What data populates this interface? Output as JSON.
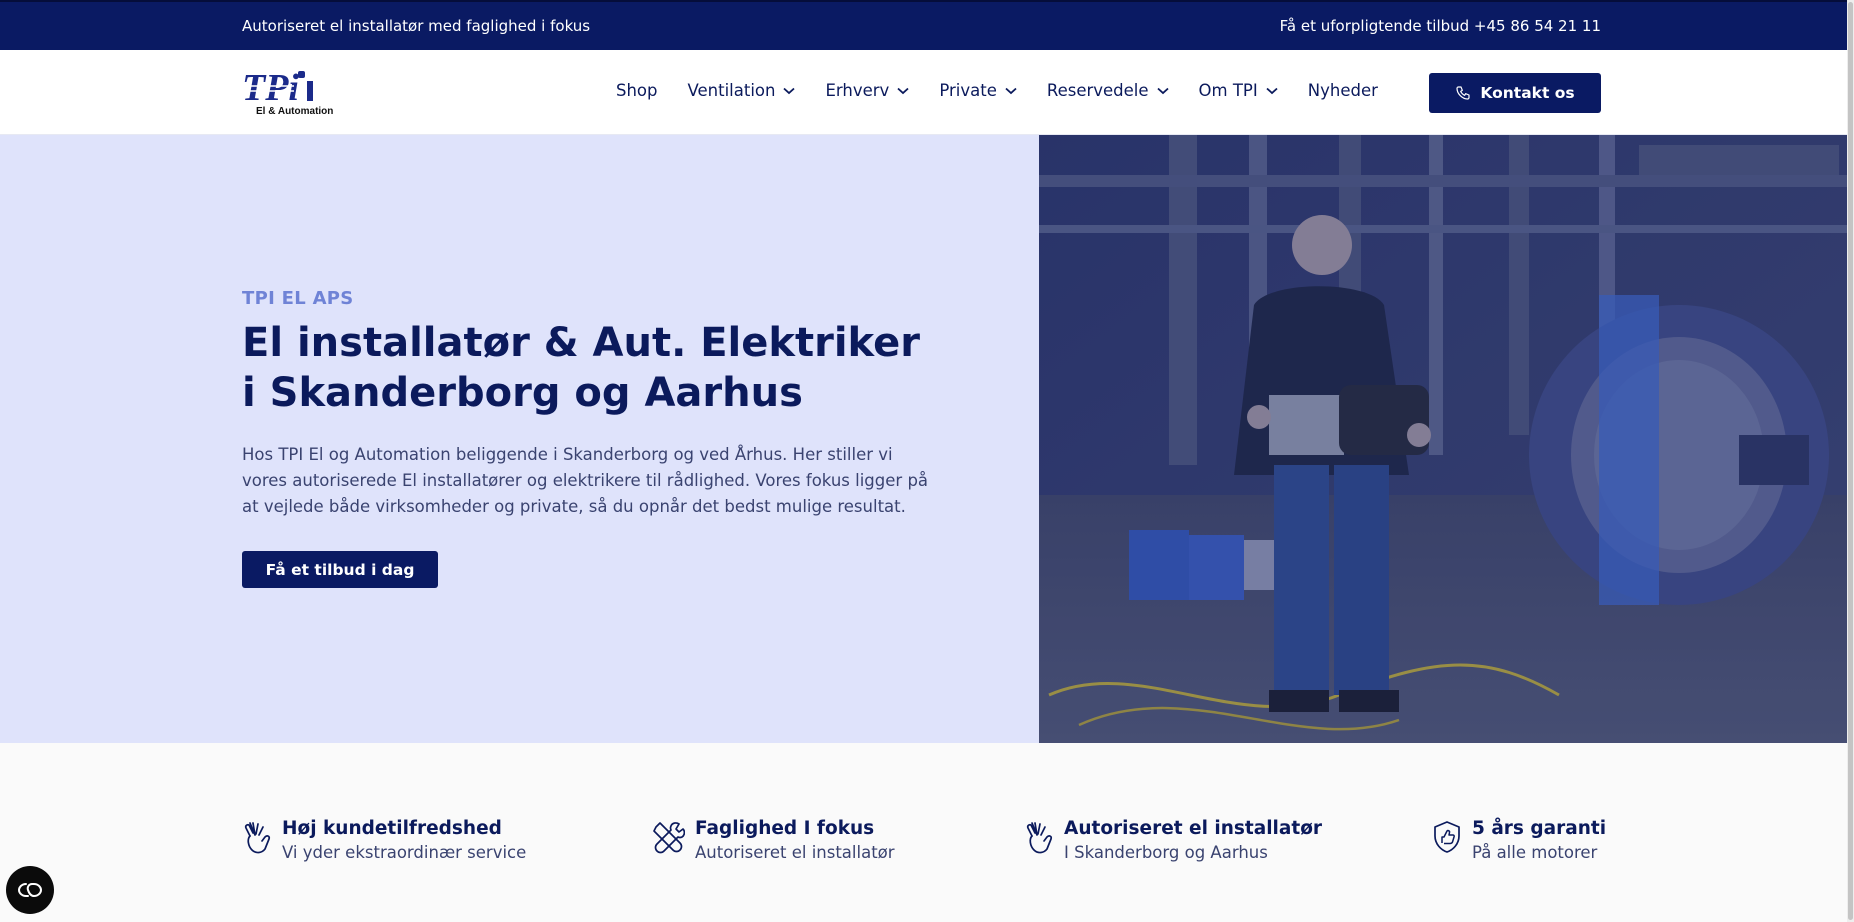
{
  "topbar": {
    "left_text": "Autoriseret el installatør med faglighed i fokus",
    "right_text": "Få et uforpligtende tilbud +45 86 54 21 11"
  },
  "logo": {
    "main": "TPi",
    "sub": "El & Automation"
  },
  "nav": {
    "items": [
      {
        "label": "Shop",
        "dropdown": false
      },
      {
        "label": "Ventilation",
        "dropdown": true
      },
      {
        "label": "Erhverv",
        "dropdown": true
      },
      {
        "label": "Private",
        "dropdown": true
      },
      {
        "label": "Reservedele",
        "dropdown": true
      },
      {
        "label": "Om TPI",
        "dropdown": true
      },
      {
        "label": "Nyheder",
        "dropdown": false
      }
    ],
    "cta_label": "Kontakt os"
  },
  "hero": {
    "eyebrow": "TPI EL APS",
    "title": "El installatør & Aut. Elektriker i Skanderborg og Aarhus",
    "lead": "Hos TPI El og Automation beliggende i Skanderborg og ved Århus. Her stiller vi vores autoriserede El installatører og elektrikere til rådlighed. Vores fokus ligger på at vejlede både virksomheder og private, så du opnår det bedst mulige resultat.",
    "button": "Få et tilbud i dag"
  },
  "features": [
    {
      "icon": "hand-icon",
      "title": "Høj kundetilfredshed",
      "subtitle": "Vi yder ekstraordinær service"
    },
    {
      "icon": "tools-icon",
      "title": "Faglighed I fokus",
      "subtitle": "Autoriseret el installatør"
    },
    {
      "icon": "hand-icon",
      "title": "Autoriseret el installatør",
      "subtitle": "I Skanderborg og Aarhus"
    },
    {
      "icon": "shield-icon",
      "title": "5 års garanti",
      "subtitle": "På alle motorer"
    }
  ],
  "colors": {
    "navy": "#0a1a63",
    "hero_bg": "#dfe3fb",
    "eyebrow": "#6f83d6"
  }
}
